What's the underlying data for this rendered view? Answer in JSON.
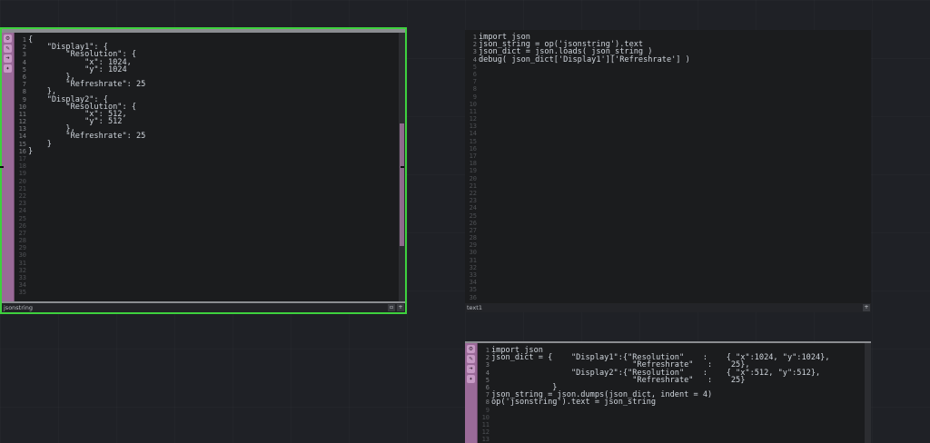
{
  "nodes": {
    "jsonstring": {
      "name": "jsonstring",
      "line_numbers": [
        "1",
        "2",
        "3",
        "4",
        "5",
        "6",
        "7",
        "8",
        "9",
        "10",
        "11",
        "12",
        "13",
        "14",
        "15",
        "16",
        "17",
        "18",
        "19",
        "20",
        "21",
        "22",
        "23",
        "24",
        "25",
        "26",
        "27",
        "28",
        "29",
        "30",
        "31",
        "32",
        "33",
        "34",
        "35"
      ],
      "lines": [
        "{",
        "    \"Display1\": {",
        "        \"Resolution\": {",
        "            \"x\": 1024,",
        "            \"y\": 1024",
        "        },",
        "        \"Refreshrate\": 25",
        "    },",
        "    \"Display2\": {",
        "        \"Resolution\": {",
        "            \"x\": 512,",
        "            \"y\": 512",
        "        },",
        "        \"Refreshrate\": 25",
        "    }",
        "}"
      ],
      "selected": true
    },
    "text1": {
      "name": "text1",
      "line_numbers": [
        "1",
        "2",
        "3",
        "4",
        "5",
        "6",
        "7",
        "8",
        "9",
        "10",
        "11",
        "12",
        "13",
        "14",
        "15",
        "16",
        "17",
        "18",
        "19",
        "20",
        "21",
        "22",
        "23",
        "24",
        "25",
        "26",
        "27",
        "28",
        "29",
        "30",
        "31",
        "32",
        "33",
        "34",
        "35",
        "36"
      ],
      "lines": [
        "import json",
        "json_string = op('jsonstring').text",
        "json_dict = json.loads( json_string )",
        "debug( json_dict['Display1']['Refreshrate'] )"
      ]
    },
    "text2": {
      "line_numbers": [
        "1",
        "2",
        "3",
        "4",
        "5",
        "6",
        "7",
        "8",
        "9",
        "10",
        "11",
        "12",
        "13"
      ],
      "lines": [
        "import json",
        "json_dict = {    \"Display1\":{\"Resolution\"    :    { \"x\":1024, \"y\":1024},",
        "                              \"Refreshrate\"   :    25},",
        "                 \"Display2\":{\"Resolution\"    :    { \"x\":512, \"y\":512},",
        "                              \"Refreshrate\"   :    25}",
        "             }",
        "json_string = json.dumps(json_dict, indent = 4)",
        "op('jsonstring').text = json_string"
      ]
    }
  },
  "colors": {
    "selected_outline": "#3ed13e",
    "strip": "#9a6a98",
    "editor_bg": "#1b1c1e",
    "canvas_bg": "#1f2126"
  },
  "icons": {
    "strip": [
      "gear-icon",
      "pencil-icon",
      "arrow-right-icon",
      "wrench-icon"
    ],
    "namebar": [
      "expand-icon",
      "add-icon"
    ]
  }
}
